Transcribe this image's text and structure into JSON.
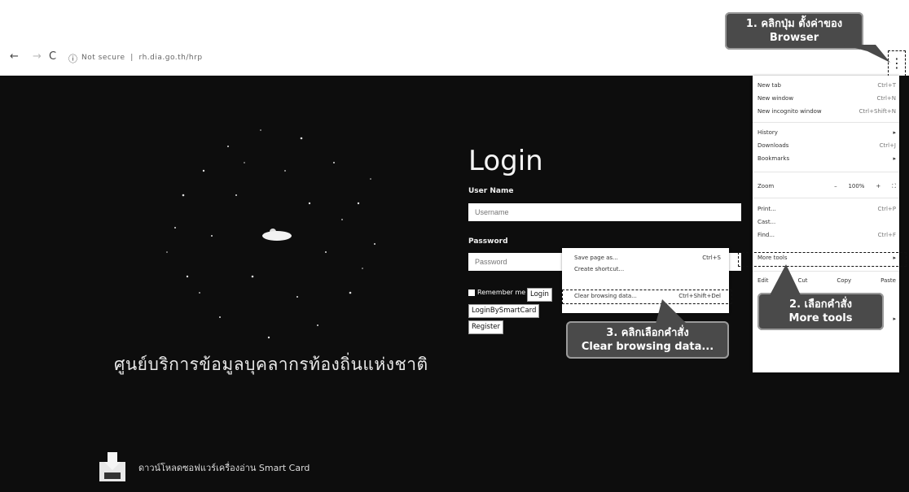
{
  "browser": {
    "back": "←",
    "forward": "→",
    "reload": "C",
    "security": "Not secure",
    "url": "rh.dia.go.th/hrp",
    "menu_icon": "⋮"
  },
  "login": {
    "title": "Login",
    "username_label": "User Name",
    "username_placeholder": "Username",
    "password_label": "Password",
    "password_placeholder": "Password",
    "remember_label": "Remember me",
    "login_button": "Login",
    "smartcard_button": "LoginBySmartCard",
    "register_button": "Register"
  },
  "branding": {
    "center_name": "ศูนย์บริการข้อมูลบุคลากรท้องถิ่นแห่งชาติ",
    "download_text": "ดาวน์โหลดซอฟแวร์เครื่องอ่าน Smart Card"
  },
  "chrome_menu": {
    "new_tab": "New tab",
    "new_tab_sc": "Ctrl+T",
    "new_window": "New window",
    "new_window_sc": "Ctrl+N",
    "incognito": "New incognito window",
    "incognito_sc": "Ctrl+Shift+N",
    "history": "History",
    "downloads": "Downloads",
    "downloads_sc": "Ctrl+J",
    "bookmarks": "Bookmarks",
    "zoom": "Zoom",
    "zoom_value": "100%",
    "zoom_minus": "–",
    "zoom_plus": "+",
    "zoom_full": "⛶",
    "print": "Print...",
    "print_sc": "Ctrl+P",
    "cast": "Cast...",
    "find": "Find...",
    "find_sc": "Ctrl+F",
    "more_tools": "More tools",
    "edit": "Edit",
    "cut": "Cut",
    "copy": "Copy",
    "paste": "Paste",
    "arrow": "▸"
  },
  "submenu": {
    "save_page": "Save page as...",
    "save_page_sc": "Ctrl+S",
    "create_shortcut": "Create shortcut...",
    "clear_browsing": "Clear browsing data...",
    "clear_browsing_sc": "Ctrl+Shift+Del"
  },
  "callouts": {
    "step1_line1": "1. คลิกปุ่ม ตั้งค่าของ",
    "step1_line2": "Browser",
    "step2_line1": "2. เลือกคำสั่ง",
    "step2_line2": "More tools",
    "step3_line1": "3. คลิกเลือกคำสั่ง",
    "step3_line2": "Clear browsing data..."
  }
}
